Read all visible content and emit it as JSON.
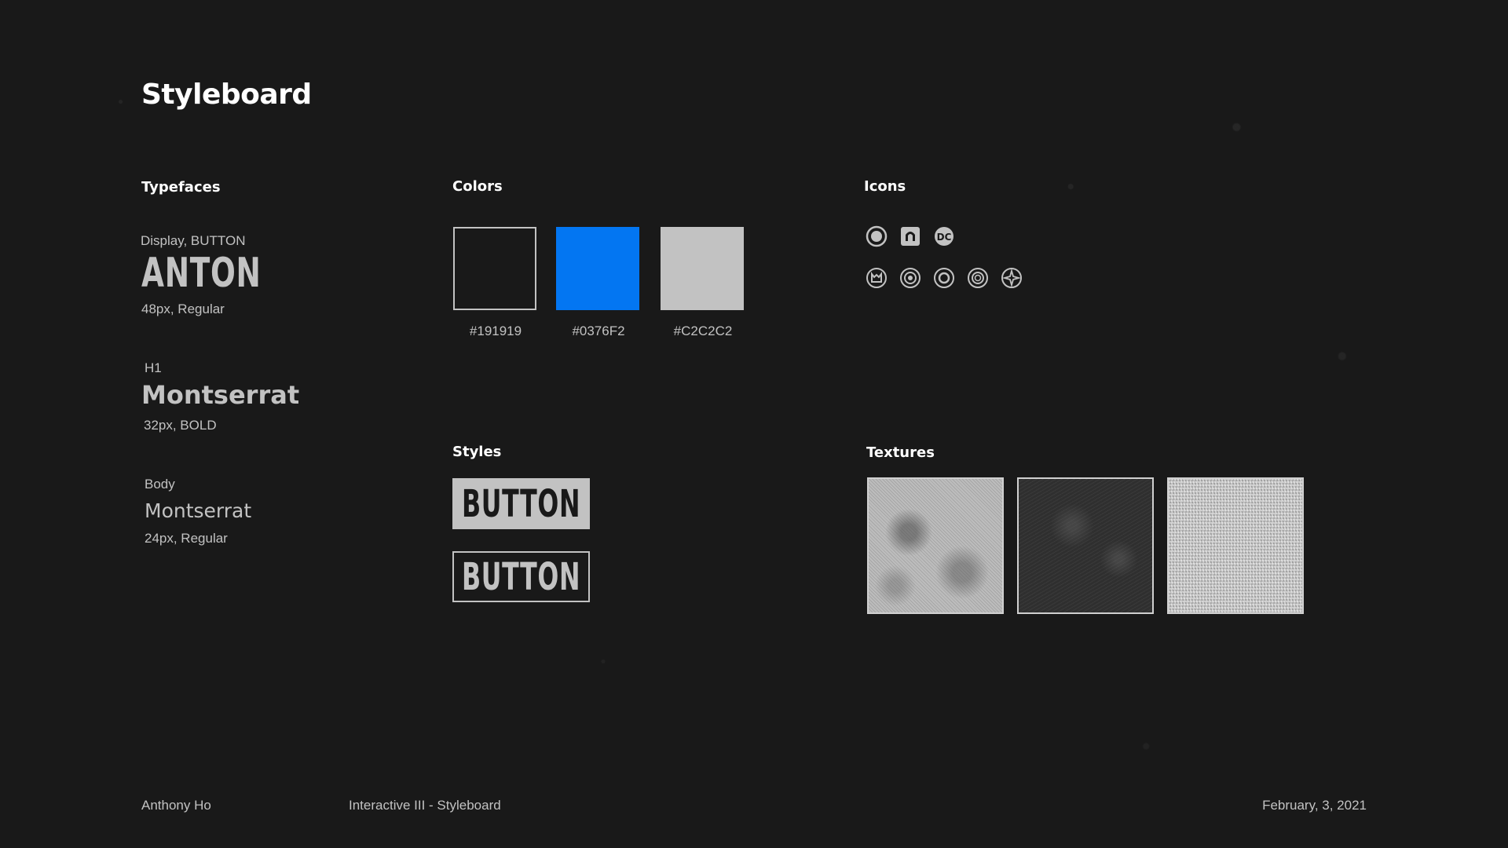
{
  "title": "Styleboard",
  "typefaces": {
    "heading": "Typefaces",
    "display": {
      "label": "Display, BUTTON",
      "sample": "ANTON",
      "spec": "48px, Regular"
    },
    "h1": {
      "label": "H1",
      "sample": "Montserrat",
      "spec": "32px, BOLD"
    },
    "body": {
      "label": "Body",
      "sample": "Montserrat",
      "spec": "24px, Regular"
    }
  },
  "colors": {
    "heading": "Colors",
    "swatches": [
      {
        "hex": "#191919",
        "label": "#191919"
      },
      {
        "hex": "#0376F2",
        "label": "#0376F2"
      },
      {
        "hex": "#C2C2C2",
        "label": "#C2C2C2"
      }
    ]
  },
  "icons": {
    "heading": "Icons",
    "items": [
      "cyborg-emblem-icon",
      "superman-emblem-icon",
      "dc-logo-icon",
      "batman-emblem-icon",
      "wonder-woman-emblem-icon",
      "flash-emblem-icon",
      "green-lantern-emblem-icon",
      "aquaman-emblem-icon"
    ]
  },
  "styles": {
    "heading": "Styles",
    "button_filled": "BUTTON",
    "button_outline": "BUTTON"
  },
  "textures": {
    "heading": "Textures"
  },
  "footer": {
    "author": "Anthony Ho",
    "project": "Interactive III - Styleboard",
    "date": "February, 3, 2021"
  }
}
